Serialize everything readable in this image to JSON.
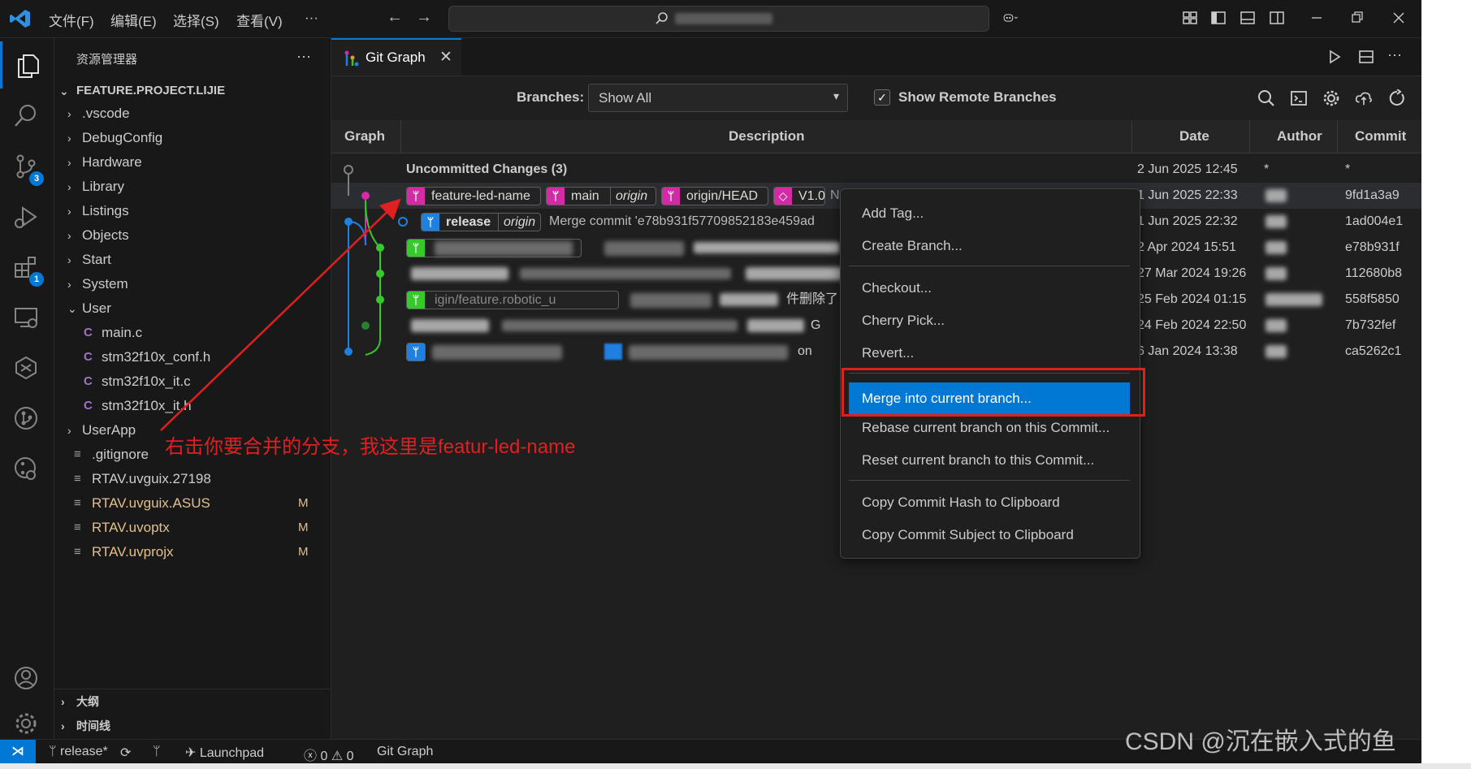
{
  "menu": [
    "文件(F)",
    "编辑(E)",
    "选择(S)",
    "查看(V)",
    "···"
  ],
  "activity_badges": {
    "scm": "3",
    "extensions": "1"
  },
  "sidebar": {
    "title": "资源管理器",
    "more": "···",
    "root": "FEATURE.PROJECT.LIJIE",
    "items": [
      {
        "label": ".vscode",
        "kind": "folder",
        "arrow": "›",
        "depth": 1
      },
      {
        "label": "DebugConfig",
        "kind": "folder",
        "arrow": "›",
        "depth": 1
      },
      {
        "label": "Hardware",
        "kind": "folder",
        "arrow": "›",
        "depth": 1
      },
      {
        "label": "Library",
        "kind": "folder",
        "arrow": "›",
        "depth": 1
      },
      {
        "label": "Listings",
        "kind": "folder",
        "arrow": "›",
        "depth": 1
      },
      {
        "label": "Objects",
        "kind": "folder",
        "arrow": "›",
        "depth": 1
      },
      {
        "label": "Start",
        "kind": "folder",
        "arrow": "›",
        "depth": 1
      },
      {
        "label": "System",
        "kind": "folder",
        "arrow": "›",
        "depth": 1
      },
      {
        "label": "User",
        "kind": "folder-open",
        "arrow": "⌄",
        "depth": 1
      },
      {
        "label": "main.c",
        "kind": "c",
        "icon": "C",
        "depth": 2
      },
      {
        "label": "stm32f10x_conf.h",
        "kind": "c",
        "icon": "C",
        "depth": 2
      },
      {
        "label": "stm32f10x_it.c",
        "kind": "c",
        "icon": "C",
        "depth": 2
      },
      {
        "label": "stm32f10x_it.h",
        "kind": "c",
        "icon": "C",
        "depth": 2
      },
      {
        "label": "UserApp",
        "kind": "folder",
        "arrow": "›",
        "depth": 1
      },
      {
        "label": ".gitignore",
        "kind": "file",
        "icon": "≡",
        "depth": 1
      },
      {
        "label": "RTAV.uvguix.27198",
        "kind": "file",
        "icon": "≡",
        "depth": 1
      },
      {
        "label": "RTAV.uvguix.ASUS",
        "kind": "modified",
        "icon": "≡",
        "mark": "M",
        "depth": 1
      },
      {
        "label": "RTAV.uvoptx",
        "kind": "modified",
        "icon": "≡",
        "mark": "M",
        "depth": 1
      },
      {
        "label": "RTAV.uvprojx",
        "kind": "modified",
        "icon": "≡",
        "mark": "M",
        "depth": 1
      }
    ],
    "outline": "大纲",
    "timeline": "时间线"
  },
  "tab": {
    "label": "Git Graph",
    "close": "✕"
  },
  "controls": {
    "branches_label": "Branches:",
    "branches_value": "Show All",
    "caret": "▾",
    "checkmark": "✓",
    "remote_label": "Show Remote Branches"
  },
  "table": {
    "headers": [
      "Graph",
      "Description",
      "Date",
      "Author",
      "Commit"
    ],
    "uncommitted": "Uncommitted Changes (3)",
    "rows": [
      {
        "date": "2 Jun 2025 12:45",
        "author": "*",
        "commit": "*"
      },
      {
        "date": "1 Jun 2025 22:33",
        "author": "",
        "commit": "9fd1a3a9"
      },
      {
        "date": "1 Jun 2025 22:32",
        "author": "",
        "commit": "1ad004e1"
      },
      {
        "date": "2 Apr 2024 15:51",
        "author": "",
        "commit": "e78b931f"
      },
      {
        "date": "27 Mar 2024 19:26",
        "author": "",
        "commit": "112680b8"
      },
      {
        "date": "25 Feb 2024 01:15",
        "author": "",
        "commit": "558f5850"
      },
      {
        "date": "24 Feb 2024 22:50",
        "author": "",
        "commit": "7b732fef"
      },
      {
        "date": "6 Jan 2024 13:38",
        "author": "",
        "commit": "ca5262c1"
      }
    ],
    "refs": {
      "feature": "feature-led-name",
      "main": "main",
      "origin": "origin",
      "origin_head": "origin/HEAD",
      "tag": "V1.0",
      "release": "release",
      "merge_text": "Merge commit 'e78b931f57709852183e459ad",
      "partial_ref": "igin/feature.robotic_u",
      "partial_msg": "件删除了",
      "fragment_g": "G",
      "fragment_on": "on",
      "fragment_n": "N"
    }
  },
  "context_menu": {
    "items": [
      "Add Tag...",
      "Create Branch...",
      "Checkout...",
      "Cherry Pick...",
      "Revert...",
      "Merge into current branch...",
      "Rebase current branch on this Commit...",
      "Reset current branch to this Commit...",
      "Copy Commit Hash to Clipboard",
      "Copy Commit Subject to Clipboard"
    ],
    "highlighted": "Merge into current branch..."
  },
  "status": {
    "remote_icon": "⋊",
    "branch": "release*",
    "launchpad": "Launchpad",
    "errors": "0",
    "warnings": "0",
    "git_graph": "Git Graph"
  },
  "annotation": "右击你要合并的分支，我这里是featur-led-name",
  "watermark": "CSDN @沉在嵌入式的鱼",
  "colors": {
    "accent": "#0078d4",
    "highlight_box": "#e0201a",
    "branch_magenta": "#d42aa5",
    "branch_blue": "#1f80e0",
    "branch_green": "#35c92a",
    "modified_file": "#e2c08d"
  }
}
